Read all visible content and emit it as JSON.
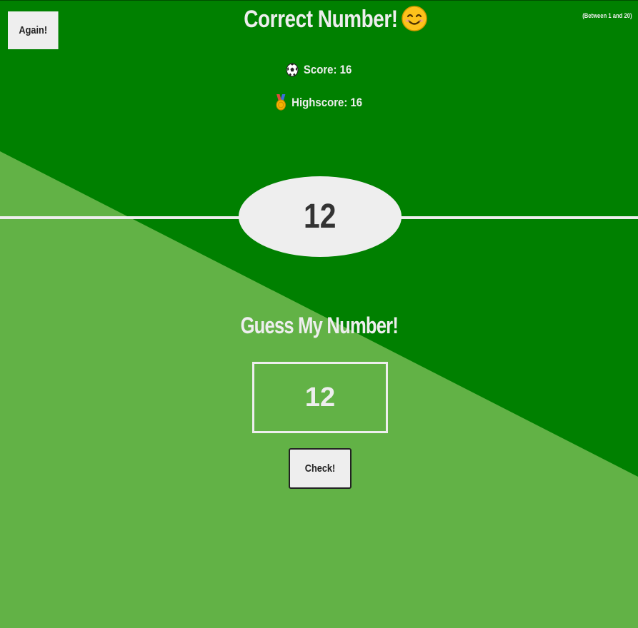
{
  "header": {
    "again_label": "Again!",
    "message": "Correct Number!",
    "message_emoji": "smiling-face",
    "range_hint": "(Between 1 and 20)"
  },
  "stats": {
    "score_label": "Score: 16",
    "score_icon": "soccer-ball-icon",
    "highscore_label": "Highscore: 16",
    "highscore_icon": "medal-icon"
  },
  "secret_number": "12",
  "guess": {
    "title": "Guess My Number!",
    "input_value": "12",
    "check_label": "Check!"
  },
  "colors": {
    "dark_field": "#008000",
    "light_field": "#62b246",
    "text": "#eeeeee"
  }
}
